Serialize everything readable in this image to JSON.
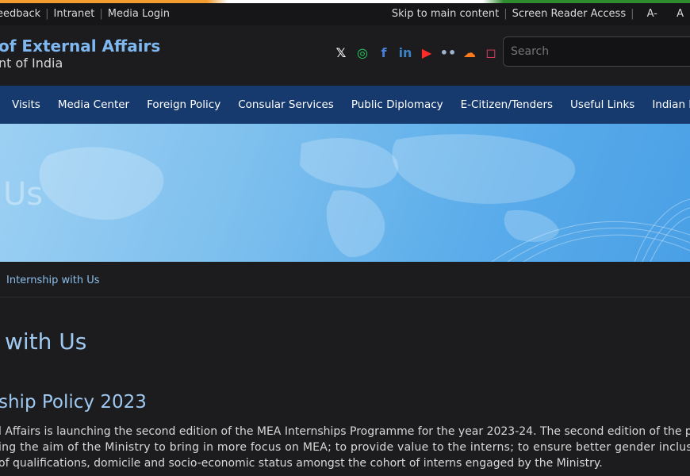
{
  "topbar": {
    "left_items": [
      "eedback",
      "Intranet",
      "Media Login"
    ],
    "right_items": [
      "Skip to main content",
      "Screen Reader Access"
    ],
    "font_small": "A-",
    "font_normal": "A"
  },
  "header": {
    "brand_line1": "of External Affairs",
    "brand_line2": "nt of India",
    "social": [
      {
        "icon": "x-icon",
        "glyph": "𝕏",
        "color": "#ffffff"
      },
      {
        "icon": "whatsapp-icon",
        "glyph": "◎",
        "color": "#25d366"
      },
      {
        "icon": "facebook-icon",
        "glyph": "f",
        "color": "#4a7fd6"
      },
      {
        "icon": "linkedin-icon",
        "glyph": "in",
        "color": "#3b82c4"
      },
      {
        "icon": "youtube-icon",
        "glyph": "▶",
        "color": "#ff2a2a"
      },
      {
        "icon": "flickr-icon",
        "glyph": "••",
        "color": "#9fb3d1"
      },
      {
        "icon": "soundcloud-icon",
        "glyph": "☁",
        "color": "#ff7a1a"
      },
      {
        "icon": "instagram-icon",
        "glyph": "◻",
        "color": "#e4405f"
      }
    ],
    "search_placeholder": "Search"
  },
  "nav": {
    "items": [
      "Visits",
      "Media Center",
      "Foreign Policy",
      "Consular Services",
      "Public Diplomacy",
      "E-Citizen/Tenders",
      "Useful Links",
      "Indian D"
    ]
  },
  "banner": {
    "title": "Us"
  },
  "breadcrumb": {
    "current": "Internship with Us"
  },
  "content": {
    "heading": "with Us",
    "subheading": "ship Policy 2023",
    "paragraph_lines": [
      "l Affairs is launching the second edition of the MEA Internships Programme for the year 2023-24. The second edition of the pro",
      "ing the aim of the Ministry to bring in more focus on MEA; to provide value to the interns; to ensure better gender inclusivi",
      "of qualifications, domicile and socio-economic status amongst the cohort of interns engaged by the Ministry."
    ]
  },
  "colors": {
    "nav_bg": "#163a6e",
    "accent": "#7fb8f0",
    "page_bg": "#1c1c1e"
  }
}
